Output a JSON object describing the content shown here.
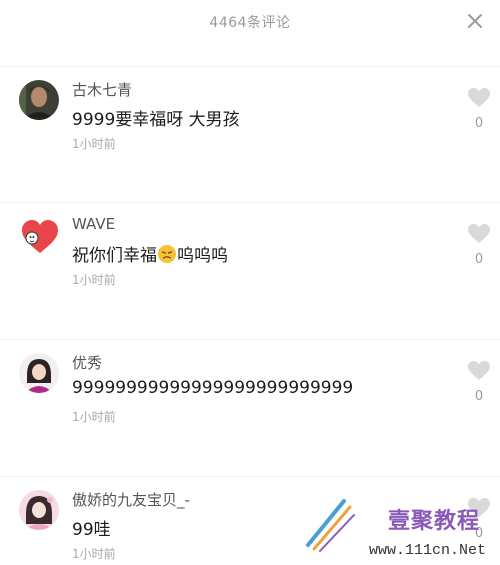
{
  "header": {
    "title": "4464条评论",
    "close_icon": "close-icon"
  },
  "comments": [
    {
      "username": "古木七青",
      "content": "9999要幸福呀  大男孩",
      "time": "1小时前",
      "likes": "0",
      "avatar_icon": "user-avatar-man"
    },
    {
      "username": "WAVE",
      "content_before": "祝你们幸福",
      "emoji_icon": "sad-face-emoji-icon",
      "content_after": "呜呜呜",
      "time": "1小时前",
      "likes": "0",
      "avatar_icon": "user-avatar-heart"
    },
    {
      "username": "优秀",
      "content": "99999999999999999999999999",
      "time": "1小时前",
      "likes": "0",
      "avatar_icon": "user-avatar-girl"
    },
    {
      "username": "傲娇的九友宝贝_-",
      "content": "99哇",
      "time": "1小时前",
      "likes": "0",
      "avatar_icon": "user-avatar-girl-pink"
    }
  ],
  "watermark": {
    "brand": "壹聚教程",
    "url": "www.111cn.Net"
  },
  "colors": {
    "like_icon": "#d9d9d9",
    "watermark_brand": "#8a5ab8"
  }
}
